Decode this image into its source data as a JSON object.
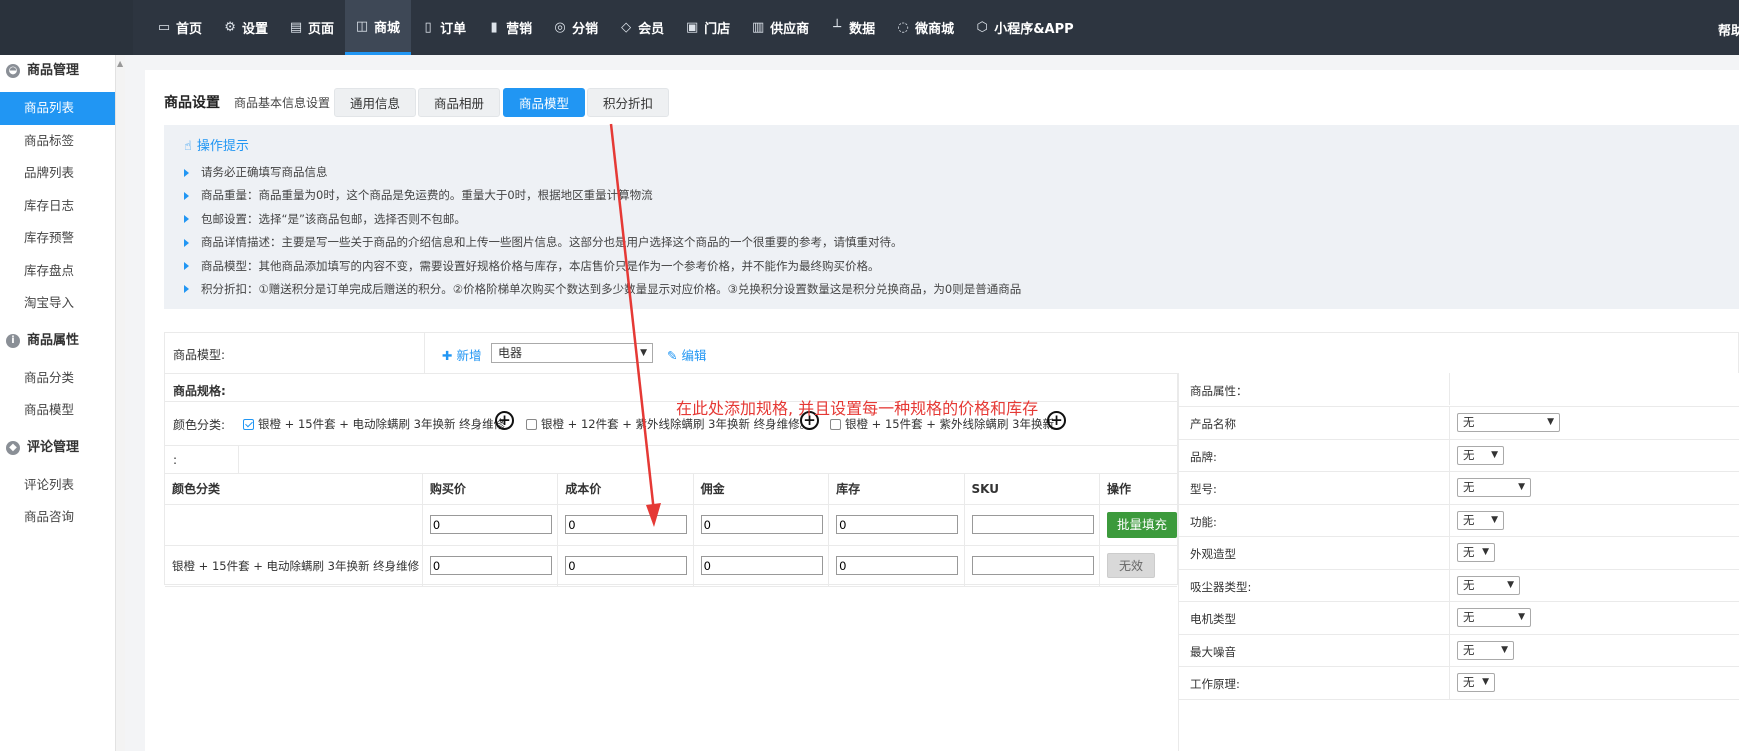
{
  "topnav": {
    "items": [
      {
        "icon": "monitor-icon",
        "label": "首页"
      },
      {
        "icon": "gear-icon",
        "label": "设置"
      },
      {
        "icon": "page-icon",
        "label": "页面"
      },
      {
        "icon": "shopping-bag-icon",
        "label": "商城"
      },
      {
        "icon": "order-icon",
        "label": "订单"
      },
      {
        "icon": "bar-chart-icon",
        "label": "营销"
      },
      {
        "icon": "users-icon",
        "label": "分销"
      },
      {
        "icon": "diamond-icon",
        "label": "会员"
      },
      {
        "icon": "store-icon",
        "label": "门店"
      },
      {
        "icon": "supplier-icon",
        "label": "供应商"
      },
      {
        "icon": "stats-icon",
        "label": "数据"
      },
      {
        "icon": "wechat-icon",
        "label": "微商城"
      },
      {
        "icon": "cube-icon",
        "label": "小程序&APP"
      }
    ],
    "active_index": 3,
    "help": "帮助"
  },
  "sidebar": {
    "groups": [
      {
        "icon": "bag-icon",
        "title": "商品管理",
        "items": [
          "商品列表",
          "商品标签",
          "品牌列表",
          "库存日志",
          "库存预警",
          "库存盘点",
          "淘宝导入"
        ]
      },
      {
        "icon": "info-icon",
        "title": "商品属性",
        "items": [
          "商品分类",
          "商品模型"
        ]
      },
      {
        "icon": "comment-icon",
        "title": "评论管理",
        "items": [
          "评论列表",
          "商品咨询"
        ]
      }
    ],
    "active_item": "商品列表"
  },
  "header": {
    "title": "商品设置",
    "subtitle": "商品基本信息设置",
    "tabs": [
      "通用信息",
      "商品相册",
      "商品模型",
      "积分折扣"
    ],
    "active_tab": "商品模型"
  },
  "tips": {
    "title": "操作提示",
    "items": [
      "请务必正确填写商品信息",
      "商品重量：商品重量为0时，这个商品是免运费的。重量大于0时，根据地区重量计算物流",
      "包邮设置：选择“是”该商品包邮，选择否则不包邮。",
      "商品详情描述：主要是写一些关于商品的介绍信息和上传一些图片信息。这部分也是用户选择这个商品的一个很重要的参考，请慎重对待。",
      "商品模型：其他商品添加填写的内容不变，需要设置好规格价格与库存，本店售价只是作为一个参考价格，并不能作为最终购买价格。",
      "积分折扣：①赠送积分是订单完成后赠送的积分。②价格阶梯单次购买个数达到多少数量显示对应价格。③兑换积分设置数量这是积分兑换商品，为0则是普通商品"
    ]
  },
  "model": {
    "label": "商品模型:",
    "add": "新增",
    "selected": "电器",
    "edit": "编辑"
  },
  "spec": {
    "title": "商品规格:",
    "color_label": "颜色分类:",
    "options": [
      {
        "text": "银橙 + 15件套 + 电动除螨刷 3年换新 终身维修",
        "checked": true
      },
      {
        "text": "银橙 + 12件套 + 紫外线除螨刷 3年换新 终身维修。",
        "checked": false
      },
      {
        "text": "银橙 + 15件套 + 紫外线除螨刷 3年换新",
        "checked": false
      }
    ],
    "empty_label": ":",
    "columns": [
      "颜色分类",
      "购买价",
      "成本价",
      "佣金",
      "库存",
      "SKU",
      "操作"
    ],
    "batch_row": {
      "values": [
        "0",
        "0",
        "0",
        "0",
        ""
      ],
      "button": "批量填充"
    },
    "rows": [
      {
        "name": "银橙 + 15件套 + 电动除螨刷 3年换新 终身维修",
        "values": [
          "0",
          "0",
          "0",
          "0",
          ""
        ],
        "button": "无效"
      }
    ]
  },
  "attributes": {
    "title": "商品属性：",
    "rows": [
      {
        "name": "产品名称",
        "value": "无",
        "size": "l"
      },
      {
        "name": "品牌:",
        "value": "无",
        "size": "s"
      },
      {
        "name": "型号:",
        "value": "无",
        "size": "m"
      },
      {
        "name": "功能:",
        "value": "无",
        "size": "s"
      },
      {
        "name": "外观造型",
        "value": "无",
        "size": "xs"
      },
      {
        "name": "吸尘器类型:",
        "value": "无",
        "size": "m2"
      },
      {
        "name": "电机类型",
        "value": "无",
        "size": "m"
      },
      {
        "name": "最大噪音",
        "value": "无",
        "size": "s2"
      },
      {
        "name": "工作原理:",
        "value": "无",
        "size": "xs"
      }
    ]
  },
  "annotation": "在此处添加规格, 并且设置每一种规格的价格和库存",
  "colors": {
    "accent": "#2196f3",
    "topbar": "#2d3540",
    "green": "#3c9a3c",
    "annotation": "#e53935"
  }
}
